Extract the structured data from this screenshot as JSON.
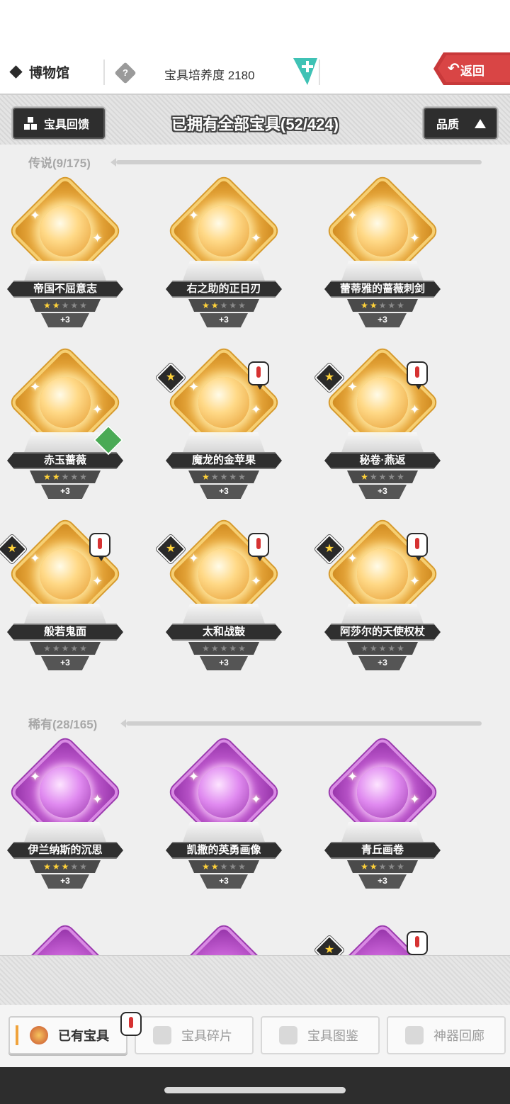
{
  "header": {
    "title": "博物馆",
    "cultivation_label": "宝具培养度 2180",
    "back_label": "返回"
  },
  "toolbar": {
    "feedback_label": "宝具回馈",
    "title": "已拥有全部宝具(52/424)",
    "sort_label": "品质"
  },
  "sections": [
    {
      "label": "传说(9/175)",
      "items": [
        {
          "name": "帝国不屈意志",
          "stars": 2,
          "level": "+3",
          "has_star_badge": false,
          "has_alert": false,
          "has_green_badge": false
        },
        {
          "name": "右之助的正日刃",
          "stars": 2,
          "level": "+3",
          "has_star_badge": false,
          "has_alert": false,
          "has_green_badge": false
        },
        {
          "name": "蕾蒂雅的蔷薇刺剑",
          "stars": 2,
          "level": "+3",
          "has_star_badge": false,
          "has_alert": false,
          "has_green_badge": false
        },
        {
          "name": "赤玉蔷薇",
          "stars": 2,
          "level": "+3",
          "has_star_badge": false,
          "has_alert": false,
          "has_green_badge": true
        },
        {
          "name": "魔龙的金苹果",
          "stars": 1,
          "level": "+3",
          "has_star_badge": true,
          "has_alert": true,
          "has_green_badge": false
        },
        {
          "name": "秘卷·燕返",
          "stars": 1,
          "level": "+3",
          "has_star_badge": true,
          "has_alert": true,
          "has_green_badge": false
        },
        {
          "name": "般若鬼面",
          "stars": 0,
          "level": "+3",
          "has_star_badge": true,
          "has_alert": true,
          "has_green_badge": false
        },
        {
          "name": "太和战鼓",
          "stars": 0,
          "level": "+3",
          "has_star_badge": true,
          "has_alert": true,
          "has_green_badge": false
        },
        {
          "name": "阿莎尔的天使权杖",
          "stars": 0,
          "level": "+3",
          "has_star_badge": true,
          "has_alert": true,
          "has_green_badge": false
        }
      ]
    },
    {
      "label": "稀有(28/165)",
      "items": [
        {
          "name": "伊兰纳斯的沉思",
          "stars": 3,
          "level": "+3",
          "has_star_badge": false,
          "has_alert": false,
          "has_green_badge": false
        },
        {
          "name": "凯撒的英勇画像",
          "stars": 2,
          "level": "+3",
          "has_star_badge": false,
          "has_alert": false,
          "has_green_badge": false
        },
        {
          "name": "青丘画卷",
          "stars": 2,
          "level": "+3",
          "has_star_badge": false,
          "has_alert": false,
          "has_green_badge": false
        }
      ]
    }
  ],
  "bottom_nav": {
    "tabs": [
      {
        "label": "已有宝具",
        "active": true
      },
      {
        "label": "宝具碎片",
        "active": false
      },
      {
        "label": "宝具图鉴",
        "active": false
      },
      {
        "label": "神器回廊",
        "active": false
      }
    ]
  },
  "colors": {
    "back_red": "#c8393a",
    "plus_teal": "#3fc2b5",
    "legend_gold": "#f3b64a",
    "rare_purple": "#c35dd2",
    "tab_accent": "#f0a33c"
  }
}
